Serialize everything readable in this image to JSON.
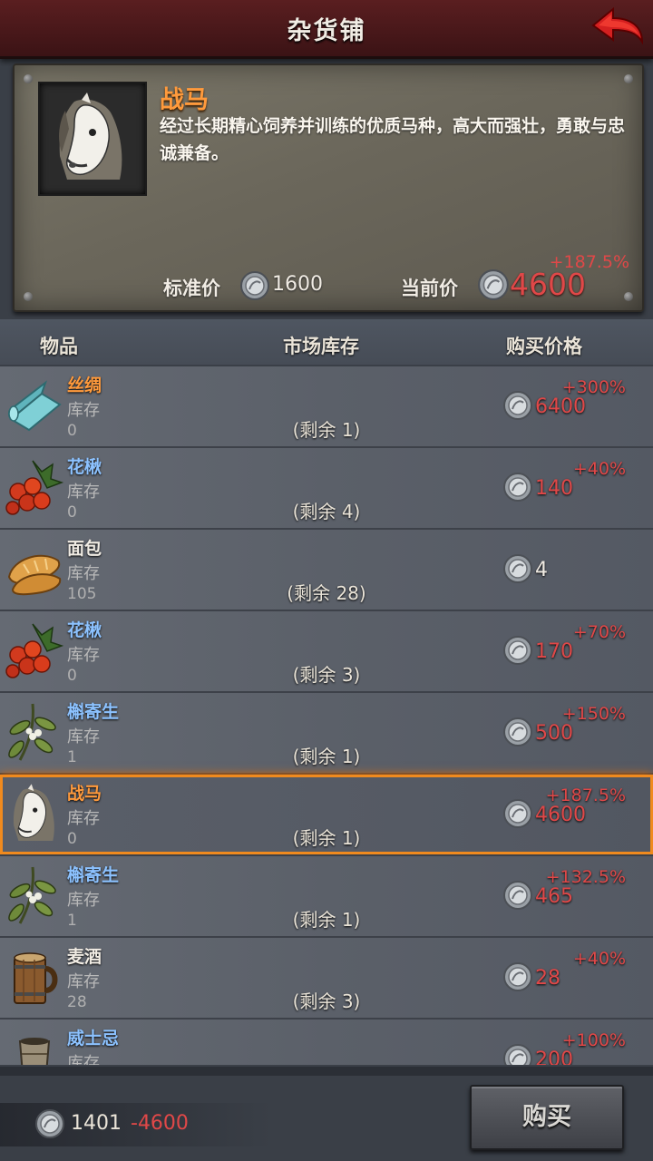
{
  "header": {
    "title": "杂货铺"
  },
  "detail": {
    "name": "战马",
    "description": "经过长期精心饲养并训练的优质马种，高大而强壮，勇敢与忠诚兼备。",
    "standard_price_label": "标准价",
    "standard_price": "1600",
    "current_price_label": "当前价",
    "current_price_pct": "+187.5%",
    "current_price": "4600"
  },
  "columns": {
    "item": "物品",
    "stock": "市场库存",
    "price": "购买价格"
  },
  "stock_label": "库存",
  "items": [
    {
      "name": "丝绸",
      "name_color": "orange",
      "icon": "silk-icon",
      "stock": "0",
      "remain": "(剩余 1)",
      "price": "6400",
      "pct": "+300%"
    },
    {
      "name": "花楸",
      "name_color": "blue",
      "icon": "rowan-berries-icon",
      "stock": "0",
      "remain": "(剩余 4)",
      "price": "140",
      "pct": "+40%"
    },
    {
      "name": "面包",
      "name_color": "white",
      "icon": "bread-icon",
      "stock": "105",
      "remain": "(剩余 28)",
      "price": "4",
      "pct": ""
    },
    {
      "name": "花楸",
      "name_color": "blue",
      "icon": "rowan-berries-icon",
      "stock": "0",
      "remain": "(剩余 3)",
      "price": "170",
      "pct": "+70%"
    },
    {
      "name": "槲寄生",
      "name_color": "blue",
      "icon": "mistletoe-icon",
      "stock": "1",
      "remain": "(剩余 1)",
      "price": "500",
      "pct": "+150%"
    },
    {
      "name": "战马",
      "name_color": "orange",
      "icon": "warhorse-icon",
      "stock": "0",
      "remain": "(剩余 1)",
      "price": "4600",
      "pct": "+187.5%",
      "selected": true
    },
    {
      "name": "槲寄生",
      "name_color": "blue",
      "icon": "mistletoe-icon",
      "stock": "1",
      "remain": "(剩余 1)",
      "price": "465",
      "pct": "+132.5%"
    },
    {
      "name": "麦酒",
      "name_color": "white",
      "icon": "ale-mug-icon",
      "stock": "28",
      "remain": "(剩余 3)",
      "price": "28",
      "pct": "+40%"
    },
    {
      "name": "威士忌",
      "name_color": "blue",
      "icon": "whisky-cup-icon",
      "stock": "",
      "remain": "",
      "price": "200",
      "pct": "+100%"
    }
  ],
  "footer": {
    "money": "1401",
    "delta": "-4600",
    "buy_label": "购买"
  }
}
